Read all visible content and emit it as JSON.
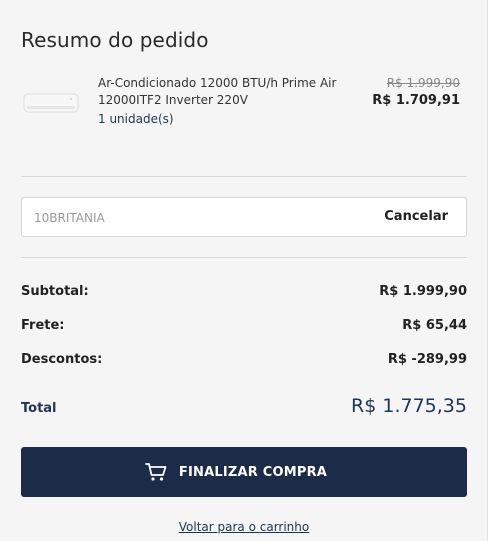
{
  "summary": {
    "title": "Resumo do pedido"
  },
  "product": {
    "name": "Ar-Condicionado 12000 BTU/h Prime Air 12000ITF2 Inverter 220V",
    "quantity": "1 unidade(s)",
    "old_price": "R$ 1.999,90",
    "price": "R$ 1.709,91",
    "image_icon": "air-conditioner-image"
  },
  "coupon": {
    "value": "10BRITANIA",
    "cancel_label": "Cancelar"
  },
  "totals": {
    "subtotal_label": "Subtotal:",
    "subtotal_value": "R$ 1.999,90",
    "shipping_label": "Frete:",
    "shipping_value": "R$ 65,44",
    "discount_label": "Descontos:",
    "discount_value": "R$ -289,99",
    "total_label": "Total",
    "total_value": "R$ 1.775,35"
  },
  "actions": {
    "checkout_label": "FINALIZAR COMPRA",
    "checkout_icon": "shopping-cart-icon",
    "back_label": "Voltar para o carrinho"
  },
  "colors": {
    "primary": "#1c2b47",
    "accent_text": "#1e3555",
    "panel_bg": "#f5f5f5"
  }
}
